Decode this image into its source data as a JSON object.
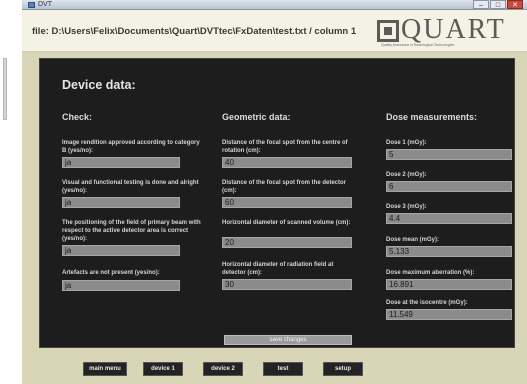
{
  "window": {
    "title": "DVT"
  },
  "header": {
    "file_path": "file: D:\\Users\\Felix\\Documents\\Quart\\DVTtec\\FxDaten\\test.txt / column 1"
  },
  "logo": {
    "word": "QUART",
    "tagline": "Quality Assurance in Radiological Technologies"
  },
  "panel": {
    "title": "Device data:"
  },
  "check": {
    "heading": "Check:",
    "items": [
      {
        "label": "Image rendition approved according to category B (yes/no):",
        "value": "ja"
      },
      {
        "label": "Visual and functional testing is done and alright (yes/no):",
        "value": "ja"
      },
      {
        "label": "The positioning of the field of primary beam with respect to the active detector area is correct (yes/no):",
        "value": "ja"
      },
      {
        "label": "Artefacts are not present  (yes/no):",
        "value": "ja"
      }
    ]
  },
  "geometric": {
    "heading": "Geometric data:",
    "items": [
      {
        "label": "Distance of the focal spot from the centre of rotation (cm):",
        "value": "40"
      },
      {
        "label": "Distance of the focal spot from the detector (cm):",
        "value": "60"
      },
      {
        "label": "Horizontal diameter of scanned volume (cm):",
        "value": "20"
      },
      {
        "label": "Horizontal diameter of radiation field at detector (cm):",
        "value": "30"
      }
    ]
  },
  "dose": {
    "heading": "Dose measurements:",
    "items": [
      {
        "label": "Dose 1 (mGy):",
        "value": "5"
      },
      {
        "label": "Dose 2 (mGy):",
        "value": "6"
      },
      {
        "label": "Dose 3 (mGy):",
        "value": "4.4"
      },
      {
        "label": "Dose mean (mGy):",
        "value": "5.133"
      },
      {
        "label": "Dose maximum aberration (%):",
        "value": "16.891"
      },
      {
        "label": "Dose at the isocentre (mGy):",
        "value": "11.549"
      }
    ]
  },
  "actions": {
    "save": "save changes"
  },
  "nav": {
    "main_menu": "main menu",
    "device1": "device 1",
    "device2": "device 2",
    "test": "test",
    "setup": "setup"
  }
}
